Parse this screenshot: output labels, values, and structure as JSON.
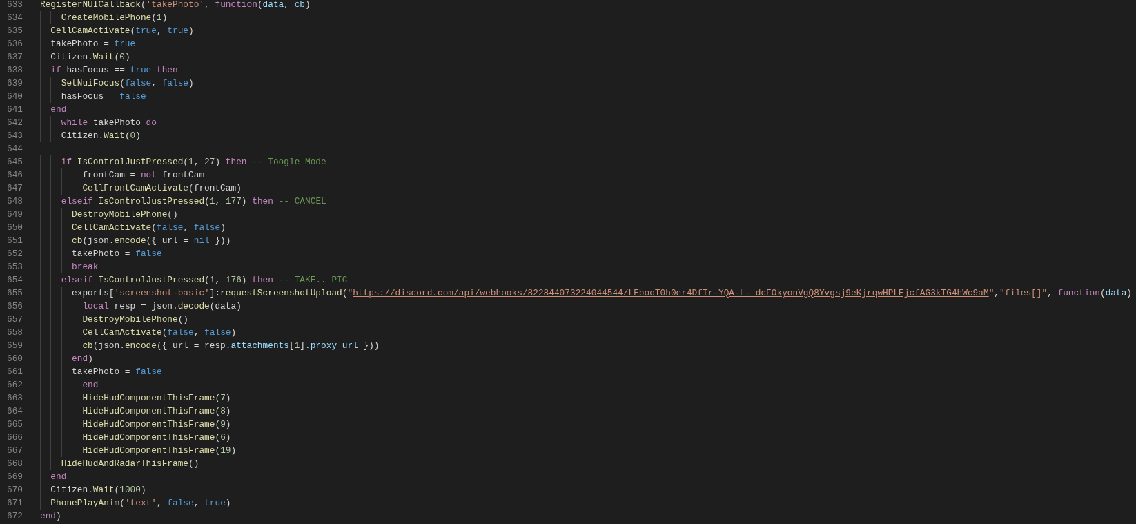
{
  "editor": {
    "lines": [
      {
        "number": "633",
        "tokens": [
          {
            "kind": "fn",
            "text": "RegisterNUICallback"
          },
          {
            "kind": "plain",
            "text": "("
          },
          {
            "kind": "str",
            "text": "'takePhoto'"
          },
          {
            "kind": "plain",
            "text": ", "
          },
          {
            "kind": "kw",
            "text": "function"
          },
          {
            "kind": "plain",
            "text": "("
          },
          {
            "kind": "var",
            "text": "data"
          },
          {
            "kind": "plain",
            "text": ", "
          },
          {
            "kind": "var",
            "text": "cb"
          },
          {
            "kind": "plain",
            "text": ")"
          }
        ]
      },
      {
        "number": "634",
        "tokens": [
          {
            "kind": "fn",
            "text": "    CreateMobilePhone"
          },
          {
            "kind": "plain",
            "text": "("
          },
          {
            "kind": "num",
            "text": "1"
          },
          {
            "kind": "plain",
            "text": ")"
          }
        ]
      },
      {
        "number": "635",
        "tokens": [
          {
            "kind": "fn",
            "text": "  CellCamActivate"
          },
          {
            "kind": "plain",
            "text": "("
          },
          {
            "kind": "const",
            "text": "true"
          },
          {
            "kind": "plain",
            "text": ", "
          },
          {
            "kind": "const",
            "text": "true"
          },
          {
            "kind": "plain",
            "text": ")"
          }
        ]
      },
      {
        "number": "636",
        "tokens": [
          {
            "kind": "plain",
            "text": "  takePhoto = "
          },
          {
            "kind": "const",
            "text": "true"
          }
        ]
      },
      {
        "number": "637",
        "tokens": [
          {
            "kind": "plain",
            "text": "  Citizen."
          },
          {
            "kind": "fn",
            "text": "Wait"
          },
          {
            "kind": "plain",
            "text": "("
          },
          {
            "kind": "num",
            "text": "0"
          },
          {
            "kind": "plain",
            "text": ")"
          }
        ]
      },
      {
        "number": "638",
        "tokens": [
          {
            "kind": "kw",
            "text": "  if"
          },
          {
            "kind": "plain",
            "text": " hasFocus == "
          },
          {
            "kind": "const",
            "text": "true "
          },
          {
            "kind": "kw",
            "text": "then"
          }
        ]
      },
      {
        "number": "639",
        "tokens": [
          {
            "kind": "fn",
            "text": "    SetNuiFocus"
          },
          {
            "kind": "plain",
            "text": "("
          },
          {
            "kind": "const",
            "text": "false"
          },
          {
            "kind": "plain",
            "text": ", "
          },
          {
            "kind": "const",
            "text": "false"
          },
          {
            "kind": "plain",
            "text": ")"
          }
        ]
      },
      {
        "number": "640",
        "tokens": [
          {
            "kind": "plain",
            "text": "    hasFocus = "
          },
          {
            "kind": "const",
            "text": "false"
          }
        ]
      },
      {
        "number": "641",
        "tokens": [
          {
            "kind": "kw",
            "text": "  end"
          }
        ]
      },
      {
        "number": "642",
        "tokens": [
          {
            "kind": "kw",
            "text": "    while"
          },
          {
            "kind": "plain",
            "text": " takePhoto "
          },
          {
            "kind": "kw",
            "text": "do"
          }
        ]
      },
      {
        "number": "643",
        "tokens": [
          {
            "kind": "plain",
            "text": "    Citizen."
          },
          {
            "kind": "fn",
            "text": "Wait"
          },
          {
            "kind": "plain",
            "text": "("
          },
          {
            "kind": "num",
            "text": "0"
          },
          {
            "kind": "plain",
            "text": ")"
          }
        ]
      },
      {
        "number": "644"
      },
      {
        "number": "645",
        "tokens": [
          {
            "kind": "kw",
            "text": "    if "
          },
          {
            "kind": "fn",
            "text": "IsControlJustPressed"
          },
          {
            "kind": "plain",
            "text": "("
          },
          {
            "kind": "num",
            "text": "1"
          },
          {
            "kind": "plain",
            "text": ", "
          },
          {
            "kind": "num",
            "text": "27"
          },
          {
            "kind": "plain",
            "text": ") "
          },
          {
            "kind": "kw",
            "text": "then "
          },
          {
            "kind": "cm",
            "text": "-- Toogle Mode"
          }
        ]
      },
      {
        "number": "646",
        "tokens": [
          {
            "kind": "plain",
            "text": "        frontCam = "
          },
          {
            "kind": "kw",
            "text": "not"
          },
          {
            "kind": "plain",
            "text": " frontCam"
          }
        ]
      },
      {
        "number": "647",
        "tokens": [
          {
            "kind": "fn",
            "text": "        CellFrontCamActivate"
          },
          {
            "kind": "plain",
            "text": "(frontCam)"
          }
        ]
      },
      {
        "number": "648",
        "tokens": [
          {
            "kind": "kw",
            "text": "    elseif "
          },
          {
            "kind": "fn",
            "text": "IsControlJustPressed"
          },
          {
            "kind": "plain",
            "text": "("
          },
          {
            "kind": "num",
            "text": "1"
          },
          {
            "kind": "plain",
            "text": ", "
          },
          {
            "kind": "num",
            "text": "177"
          },
          {
            "kind": "plain",
            "text": ") "
          },
          {
            "kind": "kw",
            "text": "then "
          },
          {
            "kind": "cm",
            "text": "-- CANCEL"
          }
        ]
      },
      {
        "number": "649",
        "tokens": [
          {
            "kind": "fn",
            "text": "      DestroyMobilePhone"
          },
          {
            "kind": "plain",
            "text": "()"
          }
        ]
      },
      {
        "number": "650",
        "tokens": [
          {
            "kind": "fn",
            "text": "      CellCamActivate"
          },
          {
            "kind": "plain",
            "text": "("
          },
          {
            "kind": "const",
            "text": "false"
          },
          {
            "kind": "plain",
            "text": ", "
          },
          {
            "kind": "const",
            "text": "false"
          },
          {
            "kind": "plain",
            "text": ")"
          }
        ]
      },
      {
        "number": "651",
        "tokens": [
          {
            "kind": "fn",
            "text": "      cb"
          },
          {
            "kind": "plain",
            "text": "(json."
          },
          {
            "kind": "fn",
            "text": "encode"
          },
          {
            "kind": "plain",
            "text": "({ url = "
          },
          {
            "kind": "const",
            "text": "nil"
          },
          {
            "kind": "plain",
            "text": " }))"
          }
        ]
      },
      {
        "number": "652",
        "tokens": [
          {
            "kind": "plain",
            "text": "      takePhoto = "
          },
          {
            "kind": "const",
            "text": "false"
          }
        ]
      },
      {
        "number": "653",
        "tokens": [
          {
            "kind": "kw",
            "text": "      break"
          }
        ]
      },
      {
        "number": "654",
        "tokens": [
          {
            "kind": "kw",
            "text": "    elseif "
          },
          {
            "kind": "fn",
            "text": "IsControlJustPressed"
          },
          {
            "kind": "plain",
            "text": "("
          },
          {
            "kind": "num",
            "text": "1"
          },
          {
            "kind": "plain",
            "text": ", "
          },
          {
            "kind": "num",
            "text": "176"
          },
          {
            "kind": "plain",
            "text": ") "
          },
          {
            "kind": "kw",
            "text": "then "
          },
          {
            "kind": "cm",
            "text": "-- TAKE.. PIC"
          }
        ]
      },
      {
        "number": "655",
        "tokens": [
          {
            "kind": "plain",
            "text": "      exports["
          },
          {
            "kind": "str",
            "text": "'screenshot-basic'"
          },
          {
            "kind": "plain",
            "text": "]:"
          },
          {
            "kind": "fn",
            "text": "requestScreenshotUpload"
          },
          {
            "kind": "plain",
            "text": "("
          },
          {
            "kind": "str",
            "text": "\""
          },
          {
            "kind": "link",
            "text": "https://discord.com/api/webhooks/822844073224044544/LEbooT0h0er4DfTr-YQA-L-_dcFOkyonVgQ8Yvgsj9eKjrqwHPLEjcfAG3kTG4hWc9aM"
          },
          {
            "kind": "str",
            "text": "\""
          },
          {
            "kind": "plain",
            "text": ","
          },
          {
            "kind": "str",
            "text": "\"files[]\""
          },
          {
            "kind": "plain",
            "text": ", "
          },
          {
            "kind": "kw",
            "text": "function"
          },
          {
            "kind": "plain",
            "text": "("
          },
          {
            "kind": "var",
            "text": "data"
          },
          {
            "kind": "plain",
            "text": ")"
          }
        ]
      },
      {
        "number": "656",
        "tokens": [
          {
            "kind": "kw",
            "text": "        local"
          },
          {
            "kind": "plain",
            "text": " resp = json."
          },
          {
            "kind": "fn",
            "text": "decode"
          },
          {
            "kind": "plain",
            "text": "(data)"
          }
        ]
      },
      {
        "number": "657",
        "tokens": [
          {
            "kind": "fn",
            "text": "        DestroyMobilePhone"
          },
          {
            "kind": "plain",
            "text": "()"
          }
        ]
      },
      {
        "number": "658",
        "tokens": [
          {
            "kind": "fn",
            "text": "        CellCamActivate"
          },
          {
            "kind": "plain",
            "text": "("
          },
          {
            "kind": "const",
            "text": "false"
          },
          {
            "kind": "plain",
            "text": ", "
          },
          {
            "kind": "const",
            "text": "false"
          },
          {
            "kind": "plain",
            "text": ")"
          }
        ]
      },
      {
        "number": "659",
        "tokens": [
          {
            "kind": "fn",
            "text": "        cb"
          },
          {
            "kind": "plain",
            "text": "(json."
          },
          {
            "kind": "fn",
            "text": "encode"
          },
          {
            "kind": "plain",
            "text": "({ url = resp."
          },
          {
            "kind": "var",
            "text": "attachments"
          },
          {
            "kind": "plain",
            "text": "["
          },
          {
            "kind": "num",
            "text": "1"
          },
          {
            "kind": "plain",
            "text": "]."
          },
          {
            "kind": "var",
            "text": "proxy_url"
          },
          {
            "kind": "plain",
            "text": " }))"
          }
        ]
      },
      {
        "number": "660",
        "tokens": [
          {
            "kind": "kw",
            "text": "      end"
          },
          {
            "kind": "plain",
            "text": ")"
          }
        ]
      },
      {
        "number": "661",
        "tokens": [
          {
            "kind": "plain",
            "text": "      takePhoto = "
          },
          {
            "kind": "const",
            "text": "false"
          }
        ]
      },
      {
        "number": "662",
        "tokens": [
          {
            "kind": "kw",
            "text": "        end"
          }
        ]
      },
      {
        "number": "663",
        "tokens": [
          {
            "kind": "fn",
            "text": "        HideHudComponentThisFrame"
          },
          {
            "kind": "plain",
            "text": "("
          },
          {
            "kind": "num",
            "text": "7"
          },
          {
            "kind": "plain",
            "text": ")"
          }
        ]
      },
      {
        "number": "664",
        "tokens": [
          {
            "kind": "fn",
            "text": "        HideHudComponentThisFrame"
          },
          {
            "kind": "plain",
            "text": "("
          },
          {
            "kind": "num",
            "text": "8"
          },
          {
            "kind": "plain",
            "text": ")"
          }
        ]
      },
      {
        "number": "665",
        "tokens": [
          {
            "kind": "fn",
            "text": "        HideHudComponentThisFrame"
          },
          {
            "kind": "plain",
            "text": "("
          },
          {
            "kind": "num",
            "text": "9"
          },
          {
            "kind": "plain",
            "text": ")"
          }
        ]
      },
      {
        "number": "666",
        "tokens": [
          {
            "kind": "fn",
            "text": "        HideHudComponentThisFrame"
          },
          {
            "kind": "plain",
            "text": "("
          },
          {
            "kind": "num",
            "text": "6"
          },
          {
            "kind": "plain",
            "text": ")"
          }
        ]
      },
      {
        "number": "667",
        "tokens": [
          {
            "kind": "fn",
            "text": "        HideHudComponentThisFrame"
          },
          {
            "kind": "plain",
            "text": "("
          },
          {
            "kind": "num",
            "text": "19"
          },
          {
            "kind": "plain",
            "text": ")"
          }
        ]
      },
      {
        "number": "668",
        "tokens": [
          {
            "kind": "fn",
            "text": "    HideHudAndRadarThisFrame"
          },
          {
            "kind": "plain",
            "text": "()"
          }
        ]
      },
      {
        "number": "669",
        "tokens": [
          {
            "kind": "kw",
            "text": "  end"
          }
        ]
      },
      {
        "number": "670",
        "tokens": [
          {
            "kind": "plain",
            "text": "  Citizen."
          },
          {
            "kind": "fn",
            "text": "Wait"
          },
          {
            "kind": "plain",
            "text": "("
          },
          {
            "kind": "num",
            "text": "1000"
          },
          {
            "kind": "plain",
            "text": ")"
          }
        ]
      },
      {
        "number": "671",
        "tokens": [
          {
            "kind": "fn",
            "text": "  PhonePlayAnim"
          },
          {
            "kind": "plain",
            "text": "("
          },
          {
            "kind": "str",
            "text": "'text'"
          },
          {
            "kind": "plain",
            "text": ", "
          },
          {
            "kind": "const",
            "text": "false"
          },
          {
            "kind": "plain",
            "text": ", "
          },
          {
            "kind": "const",
            "text": "true"
          },
          {
            "kind": "plain",
            "text": ")"
          }
        ]
      },
      {
        "number": "672",
        "tokens": [
          {
            "kind": "kw",
            "text": "end"
          },
          {
            "kind": "plain",
            "text": ")"
          }
        ]
      }
    ]
  }
}
